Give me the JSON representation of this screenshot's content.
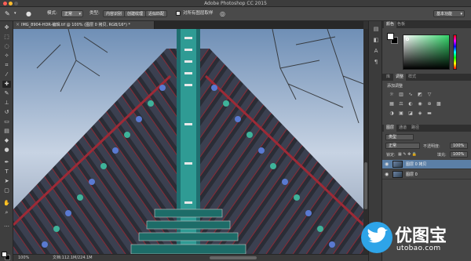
{
  "app": {
    "title": "Adobe Photoshop CC 2015"
  },
  "options": {
    "mode_label": "模式:",
    "mode_value": "正常",
    "type_label": "类型:",
    "type_buttons": [
      "内容识别",
      "创建纹理",
      "近似匹配"
    ],
    "sample_all_layers": "对所有图层取样",
    "workspace": "基本功能"
  },
  "document": {
    "tab_title": "IMG_8904-HDR-编辑.tif @ 100% (图层 0 拷贝, RGB/16*) *",
    "zoom": "100%",
    "doc_size": "文档:112.1M/224.1M"
  },
  "panels": {
    "color_tabs": [
      "颜色",
      "色板"
    ],
    "adjust_tabs": [
      "库",
      "调整",
      "样式"
    ],
    "adjust_title": "添加调整",
    "layers_tabs": [
      "图层",
      "通道",
      "路径"
    ],
    "kind_select": "类型",
    "blend_mode": "正常",
    "opacity_label": "不透明度:",
    "opacity_value": "100%",
    "lock_label": "锁定:",
    "fill_label": "填充:",
    "fill_value": "100%",
    "layers": [
      {
        "name": "图层 0 拷贝",
        "selected": true
      },
      {
        "name": "图层 0",
        "selected": false
      }
    ]
  },
  "watermark": {
    "title": "优图宝",
    "url": "utobao.com"
  },
  "colors": {
    "foreground": "#ffffff",
    "background": "#000000",
    "selection": "#5b7fa6"
  }
}
